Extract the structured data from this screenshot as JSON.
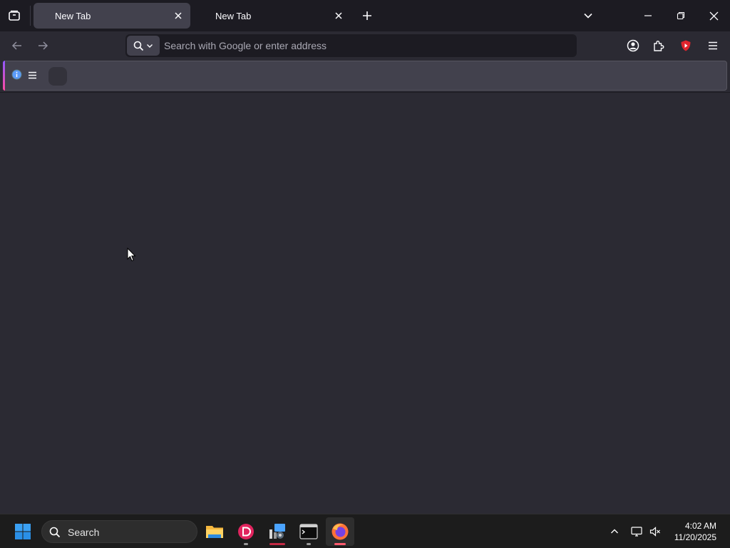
{
  "browser": {
    "tabs": [
      {
        "label": "New Tab",
        "active": true
      },
      {
        "label": "New Tab",
        "active": false
      }
    ],
    "address_bar": {
      "placeholder": "Search with Google or enter address",
      "value": ""
    }
  },
  "taskbar": {
    "search_placeholder": "Search",
    "clock": {
      "time": "4:02 AM",
      "date": "11/20/2025"
    }
  },
  "colors": {
    "tabstrip_bg": "#1c1b22",
    "toolbar_bg": "#2b2a33",
    "active_tab_bg": "#42414d",
    "accent_gradient_start": "#9059ff",
    "accent_gradient_end": "#ff4aa2",
    "extension_red": "#e0242c"
  }
}
